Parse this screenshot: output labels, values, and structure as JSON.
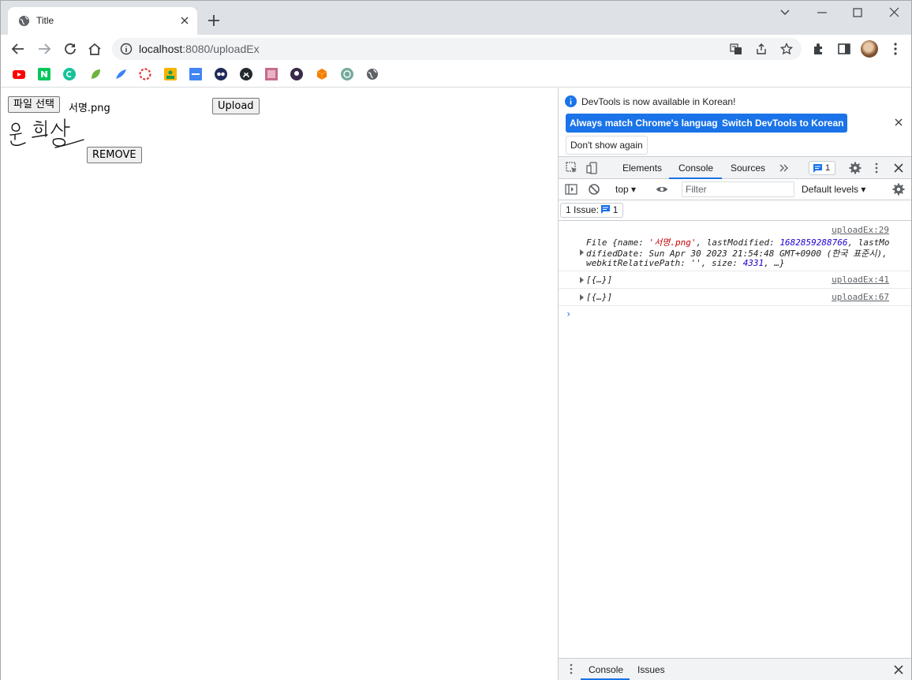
{
  "browser": {
    "tab_title": "Title",
    "url_host": "localhost",
    "url_path": ":8080/uploadEx"
  },
  "page": {
    "file_button_label": "파일 선택",
    "file_name": "서명.png",
    "upload_label": "Upload",
    "remove_label": "REMOVE"
  },
  "devtools": {
    "notice": {
      "message": "DevTools is now available in Korean!",
      "btn_match": "Always match Chrome's language",
      "btn_switch": "Switch DevTools to Korean",
      "btn_dismiss": "Don't show again"
    },
    "tabs": [
      "Elements",
      "Console",
      "Sources"
    ],
    "issues_count": "1",
    "context": "top",
    "filter_placeholder": "Filter",
    "levels": "Default levels",
    "issue_summary_label": "1 Issue:",
    "issue_summary_count": "1",
    "logs": [
      {
        "source": "uploadEx:29",
        "line1_prefix": "File {name: ",
        "line1_name": "'서명.png'",
        "line1_mid": ", lastModified: ",
        "line1_num": "1682859288766",
        "line1_suffix": ", lastMo",
        "line2": "difiedDate: Sun Apr 30 2023 21:54:48 GMT+0900 (한국 표준시),",
        "line3_prefix": "webkitRelativePath: '', size: ",
        "line3_num": "4331",
        "line3_suffix": ", …}"
      },
      {
        "source": "uploadEx:41",
        "text": "[{…}]"
      },
      {
        "source": "uploadEx:67",
        "text": "[{…}]"
      }
    ],
    "drawer_tabs": [
      "Console",
      "Issues"
    ]
  }
}
